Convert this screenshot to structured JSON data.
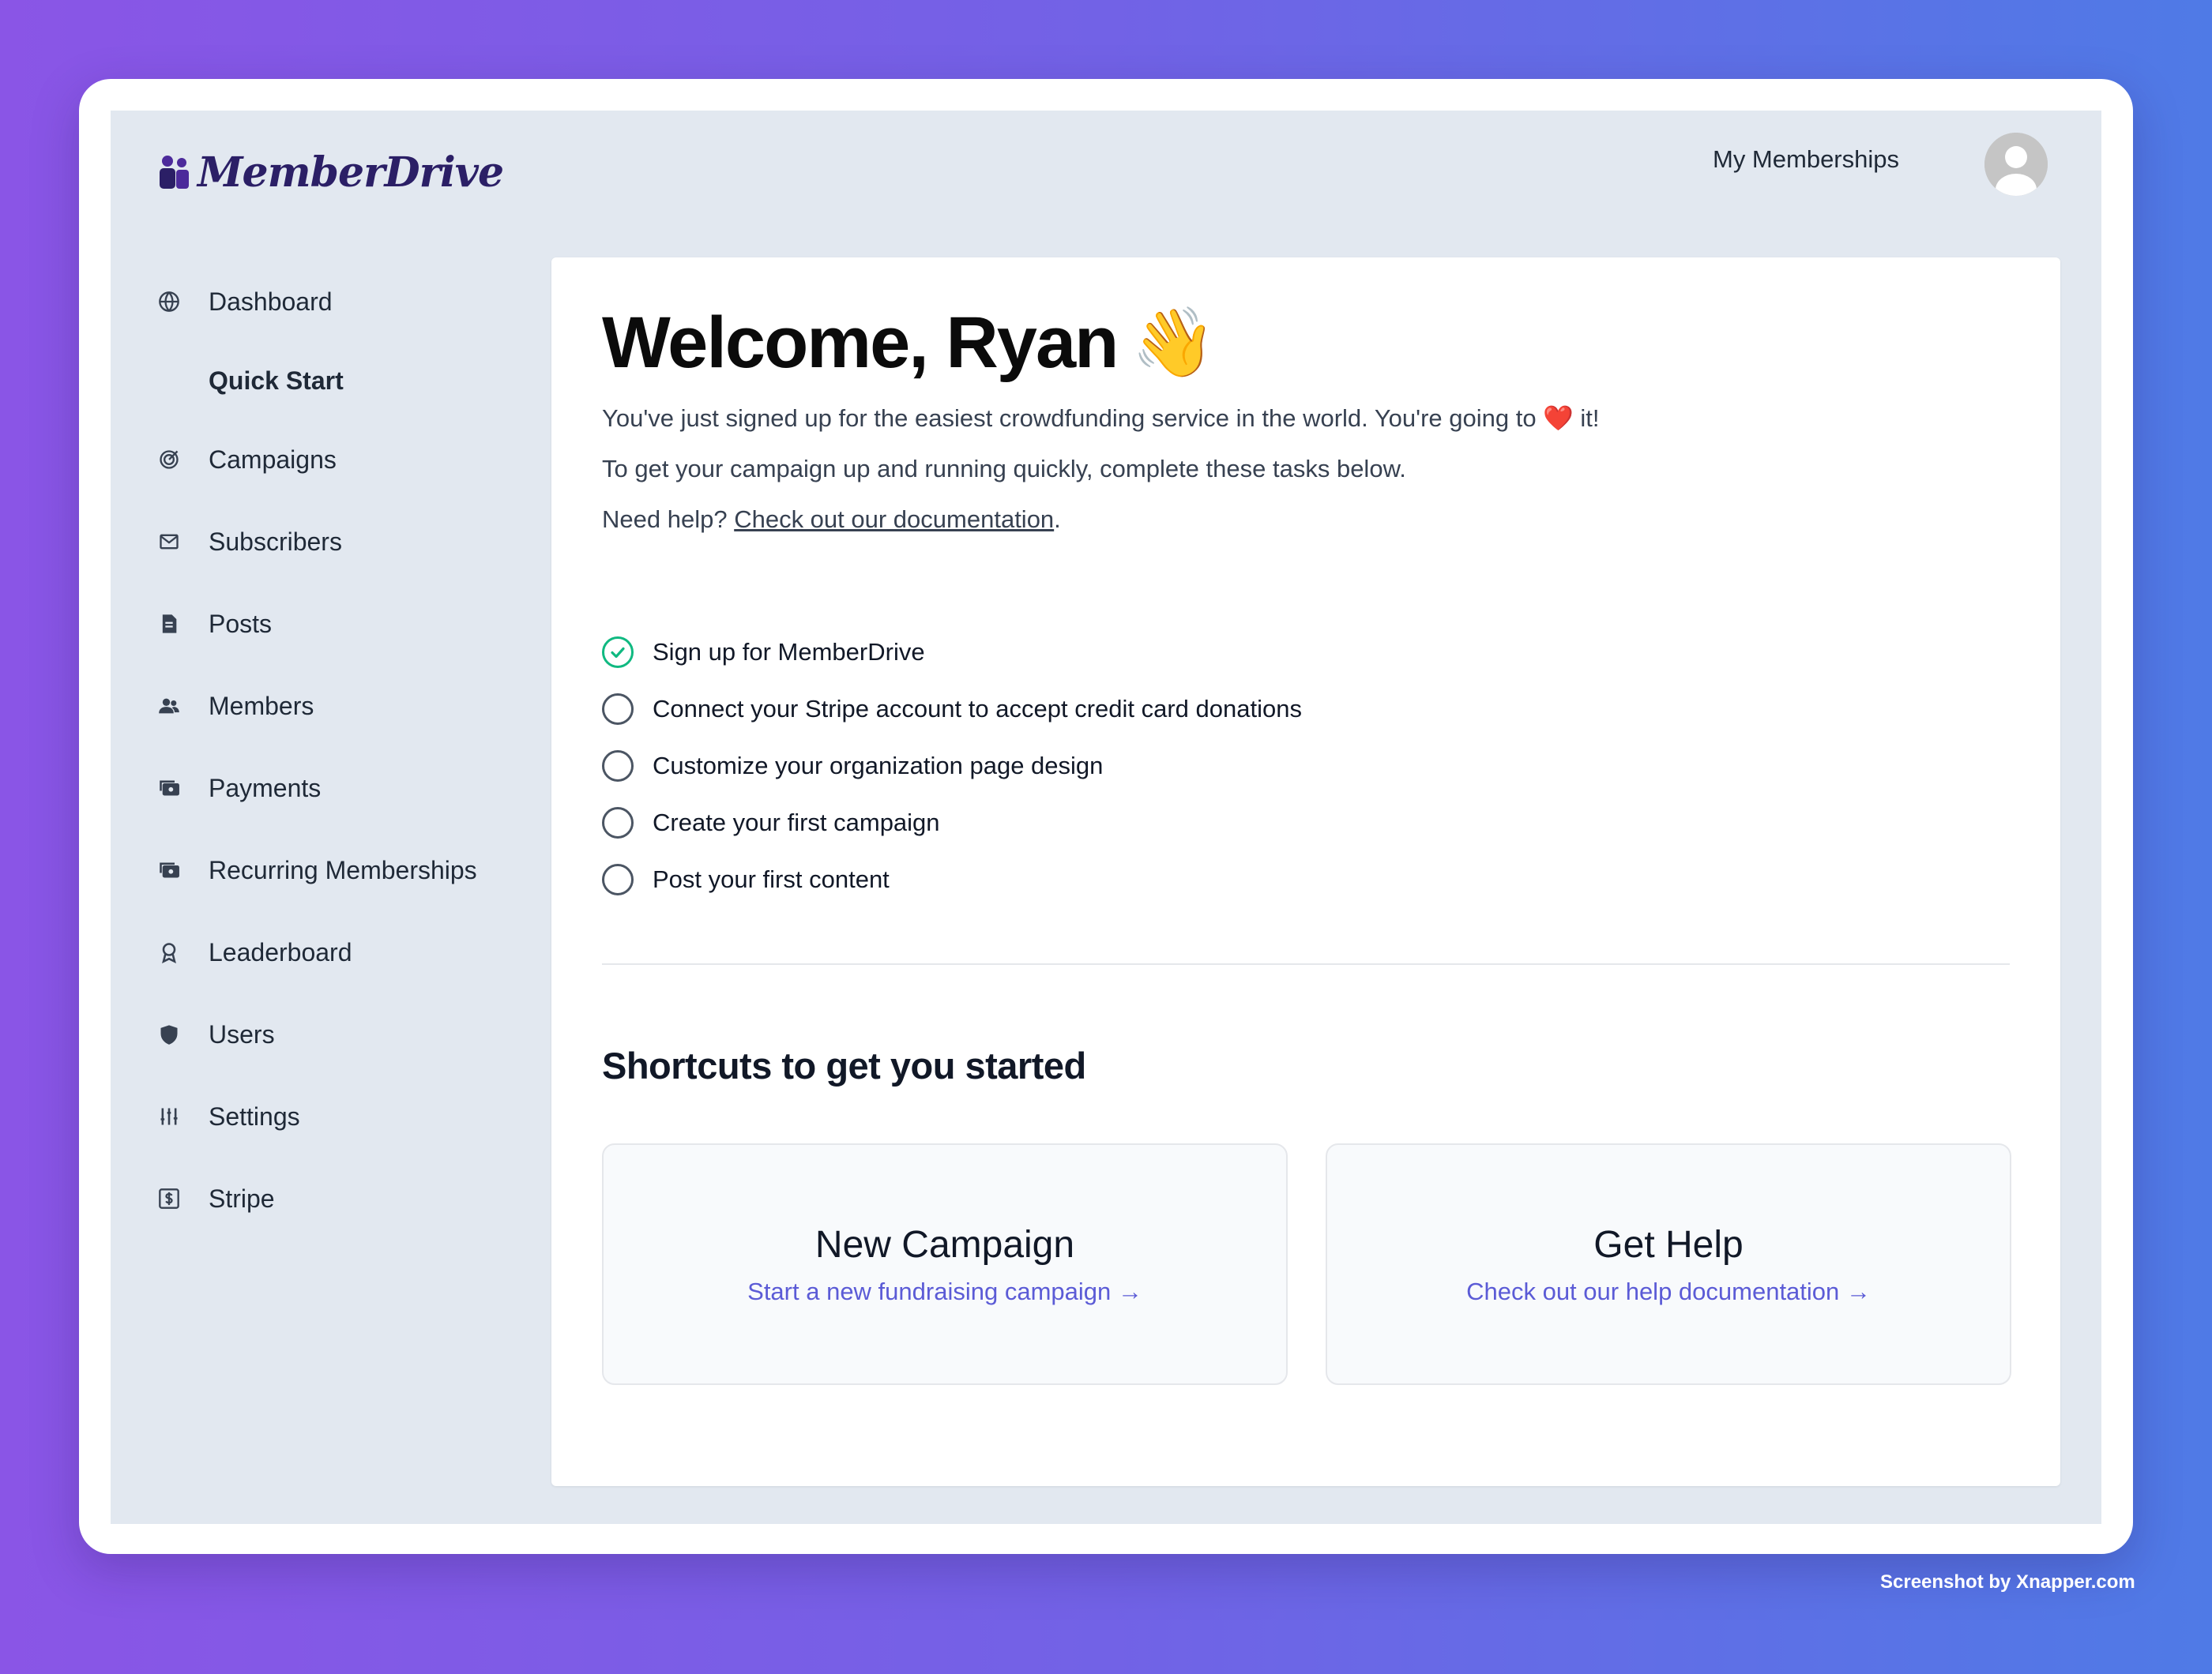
{
  "brand": {
    "name": "MemberDrive"
  },
  "header": {
    "my_memberships": "My Memberships"
  },
  "sidebar": {
    "items": [
      {
        "label": "Dashboard",
        "icon": "globe-icon"
      },
      {
        "label": "Quick Start",
        "icon": "none",
        "active": true
      },
      {
        "label": "Campaigns",
        "icon": "target-icon"
      },
      {
        "label": "Subscribers",
        "icon": "mail-icon"
      },
      {
        "label": "Posts",
        "icon": "document-icon"
      },
      {
        "label": "Members",
        "icon": "users-icon"
      },
      {
        "label": "Payments",
        "icon": "cash-icon"
      },
      {
        "label": "Recurring Memberships",
        "icon": "cash-icon"
      },
      {
        "label": "Leaderboard",
        "icon": "badge-icon"
      },
      {
        "label": "Users",
        "icon": "shield-icon"
      },
      {
        "label": "Settings",
        "icon": "sliders-icon"
      },
      {
        "label": "Stripe",
        "icon": "dollar-box-icon"
      }
    ]
  },
  "main": {
    "welcome": "Welcome, Ryan",
    "wave_emoji": "👋",
    "intro_line1_pre": "You've just signed up for the easiest crowdfunding service in the world. You're going to",
    "heart_emoji": "❤️",
    "intro_line1_post": "it!",
    "intro_line2": "To get your campaign up and running quickly, complete these tasks below.",
    "help_pre": "Need help?",
    "help_link": "Check out our documentation",
    "help_post": ".",
    "tasks": [
      {
        "label": "Sign up for MemberDrive",
        "done": true
      },
      {
        "label": "Connect your Stripe account to accept credit card donations",
        "done": false
      },
      {
        "label": "Customize your organization page design",
        "done": false
      },
      {
        "label": "Create your first campaign",
        "done": false
      },
      {
        "label": "Post your first content",
        "done": false
      }
    ],
    "shortcuts_title": "Shortcuts to get you started",
    "shortcuts": [
      {
        "title": "New Campaign",
        "link": "Start a new fundraising campaign →"
      },
      {
        "title": "Get Help",
        "link": "Check out our help documentation →"
      }
    ]
  },
  "footer": {
    "credit": "Screenshot by Xnapper.com"
  },
  "colors": {
    "accent": "#5b5bd6",
    "success": "#10b981",
    "app_bg": "#e2e8f0",
    "brand": "#2b1f66"
  }
}
